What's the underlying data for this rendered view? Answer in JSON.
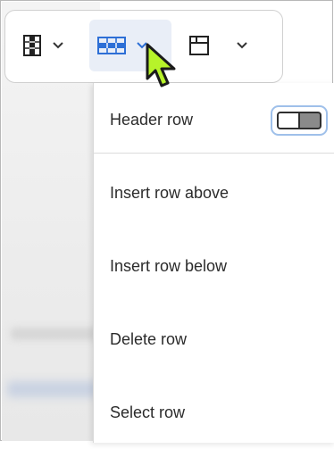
{
  "toolbar": {
    "buttons": [
      {
        "name": "column-options-button",
        "icon": "table-column-icon",
        "chevron": "chevron-down-icon",
        "active": false
      },
      {
        "name": "row-options-button",
        "icon": "table-row-icon",
        "chevron": "chevron-down-icon",
        "active": true
      },
      {
        "name": "merge-cells-button",
        "icon": "table-merge-cells-icon",
        "chevron": "chevron-down-icon",
        "active": false
      }
    ]
  },
  "menu": {
    "header_row": {
      "label": "Header row",
      "toggle_on": false
    },
    "items": [
      {
        "label": "Insert row above"
      },
      {
        "label": "Insert row below"
      },
      {
        "label": "Delete row"
      },
      {
        "label": "Select row"
      }
    ]
  },
  "colors": {
    "accent": "#2d6fd6",
    "active_bg": "#e9eef7",
    "cursor_fill": "#b7f32a",
    "toggle_focus": "#9fc0ea"
  }
}
